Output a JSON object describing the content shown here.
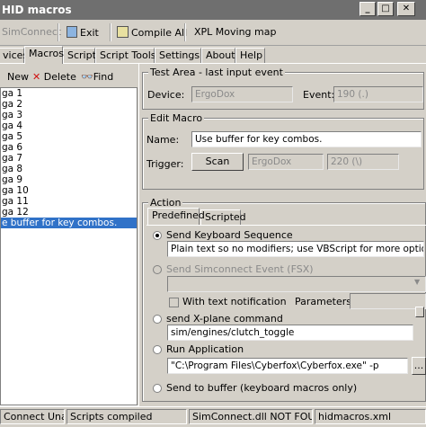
{
  "window": {
    "title": "HID macros",
    "min": "_",
    "max": "□",
    "close": "✕"
  },
  "toolbar": {
    "simconnect": "SimConnect",
    "exit": "Exit",
    "compile_all": "Compile All",
    "xpl": "XPL Moving map"
  },
  "tabs": [
    "vices",
    "Macros",
    "Script",
    "Script Tools",
    "Settings",
    "About",
    "Help"
  ],
  "list_toolbar": {
    "new": "New",
    "delete": "Delete",
    "find": "Find"
  },
  "macros": [
    "ga 1",
    "ga 2",
    "ga 3",
    "ga 4",
    "ga 5",
    "ga 6",
    "ga 7",
    "ga 8",
    "ga 9",
    "ga 10",
    "ga 11",
    "ga 12",
    "e buffer for key combos."
  ],
  "selected_index": 12,
  "test_area": {
    "legend": "Test Area - last input event",
    "device_label": "Device:",
    "device_value": "ErgoDox",
    "event_label": "Event:",
    "event_value": "190 (.)"
  },
  "edit_macro": {
    "legend": "Edit Macro",
    "name_label": "Name:",
    "name_value": "Use buffer for key combos.",
    "trigger_label": "Trigger:",
    "scan_button": "Scan",
    "trigger_device": "ErgoDox",
    "trigger_event": "220 (\\)"
  },
  "action": {
    "legend": "Action",
    "subtabs": [
      "Predefined",
      "Scripted"
    ],
    "send_keyboard": "Send Keyboard Sequence",
    "keyboard_value": "Plain text so no modifiers; use VBScript for more options.",
    "send_simconnect": "Send Simconnect Event (FSX)",
    "with_notification": "With text notification",
    "parameters_label": "Parameters:",
    "send_xplane": "send X-plane command",
    "xplane_value": "sim/engines/clutch_toggle",
    "run_app": "Run Application",
    "app_value": "\"C:\\Program Files\\Cyberfox\\Cyberfox.exe\" -p",
    "browse": "...",
    "send_buffer": "Send to buffer (keyboard macros only)"
  },
  "status": [
    "Connect Unav",
    "Scripts compiled",
    "SimConnect.dll NOT FOUN",
    "hidmacros.xml"
  ]
}
